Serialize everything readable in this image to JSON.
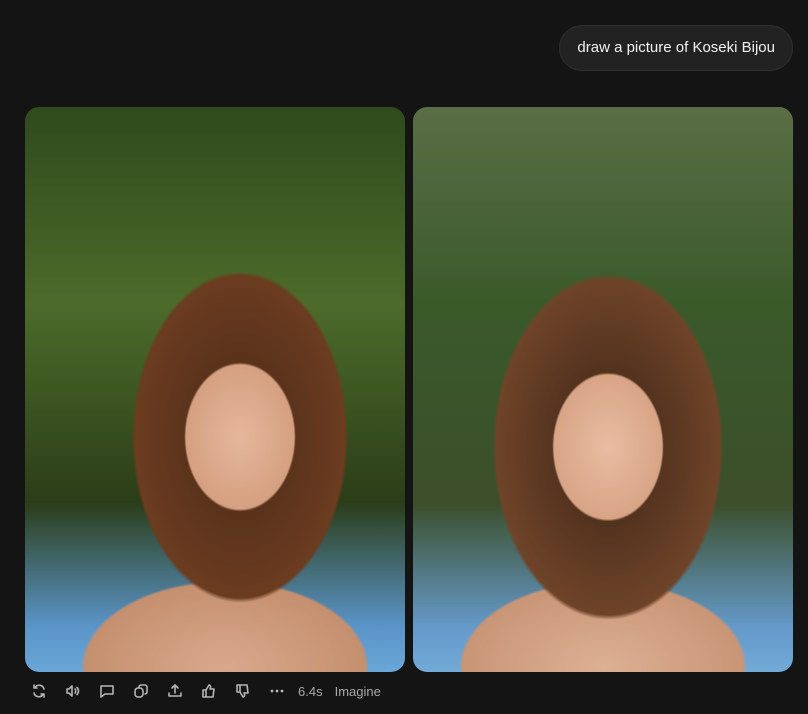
{
  "prompt": {
    "text": "draw a picture of Koseki Bijou"
  },
  "images": [
    {
      "alt": "generated image 1"
    },
    {
      "alt": "generated image 2"
    }
  ],
  "toolbar": {
    "icons": [
      "regenerate-icon",
      "read-aloud-icon",
      "comment-icon",
      "copy-icon",
      "share-icon",
      "thumbs-up-icon",
      "thumbs-down-icon",
      "more-icon"
    ],
    "duration": "6.4s",
    "mode": "Imagine"
  }
}
